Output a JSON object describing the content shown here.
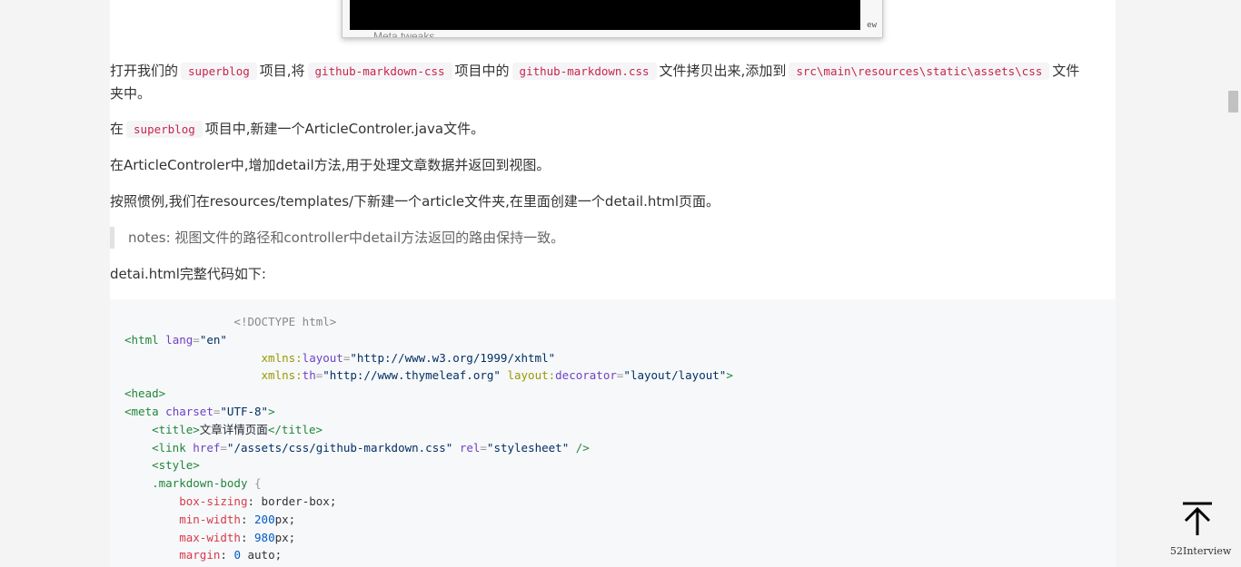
{
  "screenshot": {
    "corner_text": "ew",
    "cut_text": "Meta tweaks"
  },
  "paragraphs": {
    "p1": {
      "t1": "打开我们的",
      "c1": "superblog",
      "t2": "项目,将",
      "c2": "github-markdown-css",
      "t3": "项目中的",
      "c3": "github-markdown.css",
      "t4": "文件拷贝出来,添加到",
      "c4": "src\\main\\resources\\static\\assets\\css",
      "t5": "文件",
      "t6": "夹中。"
    },
    "p2": {
      "t1": "在",
      "c1": "superblog",
      "t2": "项目中,新建一个ArticleControler.java文件。"
    },
    "p3": "在ArticleControler中,增加detail方法,用于处理文章数据并返回到视图。",
    "p4": "按照惯例,我们在resources/templates/下新建一个article文件夹,在里面创建一个detail.html页面。",
    "quote": "notes: 视图文件的路径和controller中detail方法返回的路由保持一致。",
    "p5": "detai.html完整代码如下:"
  },
  "code": {
    "doctype": "<!DOCTYPE html>",
    "html_open": "<html",
    "attr_lang": "lang",
    "val_lang": "\"en\"",
    "ns_xmlns": "xmlns:",
    "attr_layout": "layout",
    "val_layout_ns": "\"http://www.w3.org/1999/xhtml\"",
    "attr_th": "th",
    "val_th_ns": "\"http://www.thymeleaf.org\"",
    "ns_layout": "layout:",
    "attr_decorator": "decorator",
    "val_decorator": "\"layout/layout\"",
    "close_angle": ">",
    "eq": "=",
    "head_open": "<head>",
    "meta_open": "<meta",
    "attr_charset": "charset",
    "val_charset": "\"UTF-8\"",
    "title_open": "<title>",
    "title_text": "文章详情页面",
    "title_close": "</title>",
    "link_open": "<link",
    "attr_href": "href",
    "val_href": "\"/assets/css/github-markdown.css\"",
    "attr_rel": "rel",
    "val_rel": "\"stylesheet\"",
    "self_close": " />",
    "style_open": "<style>",
    "selector": ".markdown-body",
    "brace_open": " {",
    "prop_box": "box-sizing",
    "val_box": "border-box",
    "prop_minw": "min-width",
    "val_minw_num": "200",
    "val_minw_unit": "px",
    "prop_maxw": "max-width",
    "val_maxw_num": "980",
    "val_maxw_unit": "px",
    "prop_margin": "margin",
    "val_margin_num": "0",
    "val_margin_kw": "auto",
    "colon": ": ",
    "semi": ";"
  },
  "back_to_top": {
    "icon": "arrow-up-icon",
    "label": "52Interview"
  }
}
